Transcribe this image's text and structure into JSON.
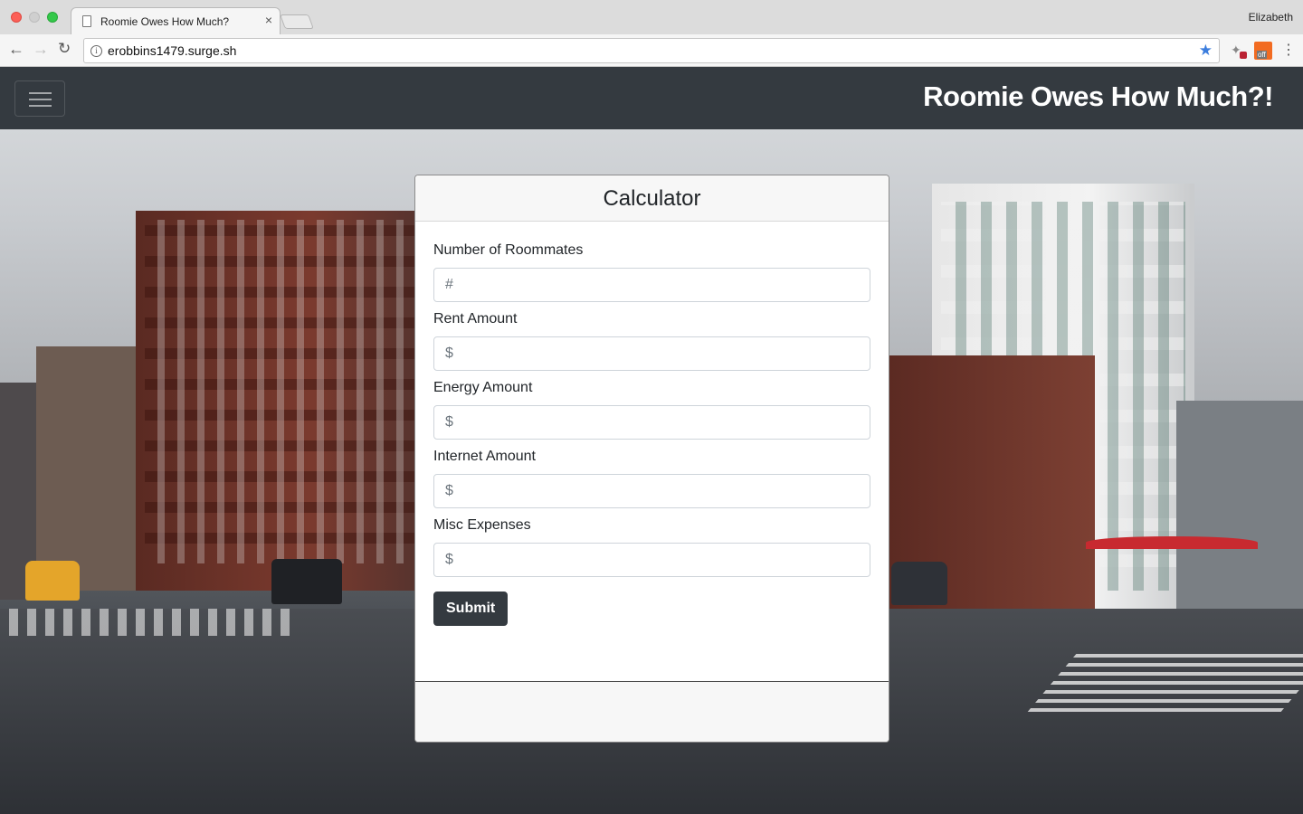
{
  "browser": {
    "tab_title": "Roomie Owes How Much?",
    "tab_close": "×",
    "profile_name": "Elizabeth",
    "url": "erobbins1479.surge.sh",
    "ext_badge": "off",
    "icons": [
      "back-arrow-icon",
      "forward-arrow-icon",
      "reload-icon",
      "info-icon",
      "star-icon",
      "extension-icon",
      "menu-kebab-icon"
    ]
  },
  "navbar": {
    "brand": "Roomie Owes How Much?!",
    "background": "#343a40"
  },
  "card": {
    "title": "Calculator",
    "fields": [
      {
        "label": "Number of Roommates",
        "placeholder": "#",
        "value": ""
      },
      {
        "label": "Rent Amount",
        "placeholder": "$",
        "value": ""
      },
      {
        "label": "Energy Amount",
        "placeholder": "$",
        "value": ""
      },
      {
        "label": "Internet Amount",
        "placeholder": "$",
        "value": ""
      },
      {
        "label": "Misc Expenses",
        "placeholder": "$",
        "value": ""
      }
    ],
    "submit_label": "Submit"
  }
}
